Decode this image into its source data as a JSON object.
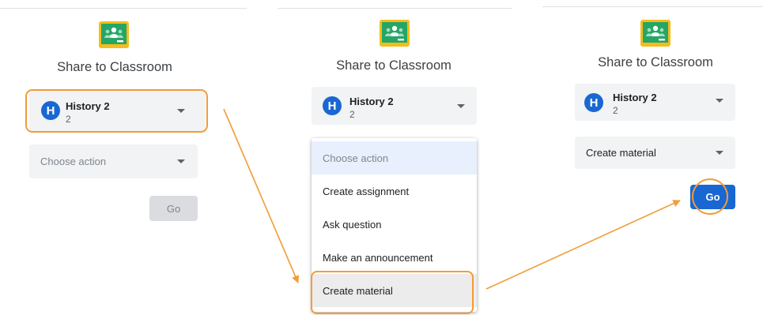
{
  "colors": {
    "accent": "#1967d2",
    "highlight": "#f29c38",
    "classroom_green": "#25a667",
    "classroom_yellow": "#f7bc1a"
  },
  "panels": [
    {
      "logo_icon": "google-classroom-icon",
      "title": "Share to Classroom",
      "class_select": {
        "avatar_letter": "H",
        "name": "History 2",
        "section": "2"
      },
      "action_select": {
        "value": "Choose action"
      },
      "go_label": "Go"
    },
    {
      "logo_icon": "google-classroom-icon",
      "title": "Share to Classroom",
      "class_select": {
        "avatar_letter": "H",
        "name": "History 2",
        "section": "2"
      },
      "action_menu": {
        "items": [
          "Choose action",
          "Create assignment",
          "Ask question",
          "Make an announcement",
          "Create material"
        ]
      }
    },
    {
      "logo_icon": "google-classroom-icon",
      "title": "Share to Classroom",
      "class_select": {
        "avatar_letter": "H",
        "name": "History 2",
        "section": "2"
      },
      "action_select": {
        "value": "Create material"
      },
      "go_label": "Go"
    }
  ]
}
